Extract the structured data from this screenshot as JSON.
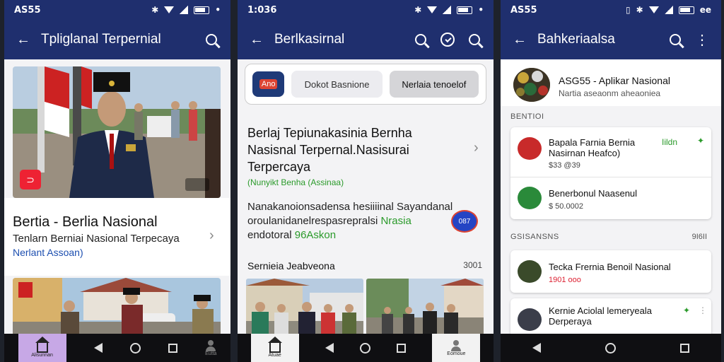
{
  "screen1": {
    "status": {
      "time": "AS55"
    },
    "toolbar": {
      "title": "Tpliglanal Terpernial"
    },
    "hero": {
      "badge": "⊙⊙",
      "corner": "▤▤"
    },
    "headline": {
      "title": "Bertia - Berlia Nasional",
      "subtitle": "Tenlarn Berniai Nasional Terpecaya",
      "link": "Nerlant Assoan)"
    },
    "nav": {
      "home_label": "Alisunnan",
      "profile_label": "Eutta"
    }
  },
  "screen2": {
    "status": {
      "time": "1:036"
    },
    "toolbar": {
      "title": "Berlkasirnal"
    },
    "chips": {
      "logo": "Ano",
      "chip_a": "Dokot Basnione",
      "chip_b": "Nerlaia tenoelof"
    },
    "article": {
      "title": "Berlaj Tepiunakasinia Bernha Nasisnal Terpernal.Nasisurai Terpercaya",
      "tag": "(Nunyikt Benha (Assinaa)",
      "body": "Nanakanoionsadensa hesiiiinal Sayandanal oroulanidanelrespasrepralsi",
      "body_green": "Nrasia",
      "body2": "endotoral",
      "body2_green": "96Askon",
      "fab": "087"
    },
    "section": {
      "title": "Sernieia Jeabveona",
      "count": "3001"
    },
    "nav": {
      "home_label": "Atuae",
      "profile_label": "Eomoue"
    }
  },
  "screen3": {
    "status": {
      "time": "AS55",
      "battery": "ee"
    },
    "toolbar": {
      "title": "Bahkeriaalsa"
    },
    "profile": {
      "name": "ASG55 - Aplikar Nasional",
      "subtitle": "Nartia aseaonm aheaoniea"
    },
    "section1": {
      "title": "BENTIOI"
    },
    "items1": [
      {
        "title": "Bapala Farnia Bernia\nNasirnan Heafco)",
        "meta": "$33 @39",
        "tag": "Iildn"
      },
      {
        "title": "Benerbonul Naasenul",
        "meta": "$ 50.0002"
      }
    ],
    "section2": {
      "title": "GSISANSNS",
      "count": "9I6II"
    },
    "items2": [
      {
        "title": "Tecka Frernia Benoil Nasional",
        "meta": "1901 ooo"
      },
      {
        "title": "Kernie Aciolal lemeryeala\nDerperaya",
        "meta": ""
      }
    ]
  }
}
